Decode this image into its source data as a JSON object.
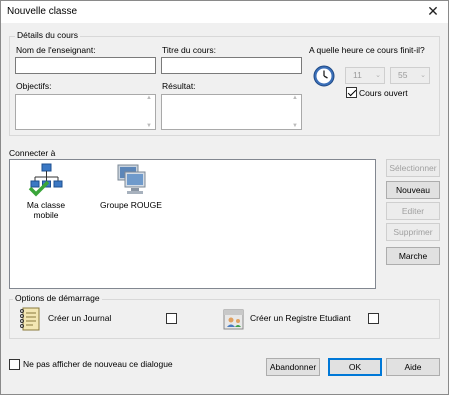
{
  "window": {
    "title": "Nouvelle classe"
  },
  "course_details": {
    "group_label": "Détails du cours",
    "teacher_label": "Nom de l'enseignant:",
    "teacher_value": "",
    "course_title_label": "Titre du cours:",
    "course_title_value": "",
    "objectives_label": "Objectifs:",
    "objectives_value": "",
    "result_label": "Résultat:",
    "result_value": "",
    "end_time_label": "A quelle heure ce cours finit-il?",
    "hour_value": "11",
    "minute_value": "55",
    "open_course_label": "Cours ouvert",
    "open_course_checked": true
  },
  "connect": {
    "label": "Connecter à",
    "items": [
      {
        "label_line1": "Ma classe",
        "label_line2": "mobile",
        "icon": "network-tree-check-icon"
      },
      {
        "label_line1": "Groupe ROUGE",
        "label_line2": "",
        "icon": "computer-group-icon"
      }
    ],
    "buttons": {
      "select": "Sélectionner",
      "new": "Nouveau",
      "edit": "Editer",
      "delete": "Supprimer",
      "start": "Marche"
    }
  },
  "startup_options": {
    "group_label": "Options de démarrage",
    "journal_label": "Créer un Journal",
    "journal_checked": false,
    "register_label": "Créer un Registre Etudiant",
    "register_checked": false
  },
  "footer": {
    "dont_show_label": "Ne pas afficher de nouveau ce dialogue",
    "dont_show_checked": false,
    "cancel": "Abandonner",
    "ok": "OK",
    "help": "Aide"
  },
  "colors": {
    "focus": "#0078d7",
    "window_bg": "#f0f0f0",
    "disabled_text": "#a0a0a0"
  }
}
